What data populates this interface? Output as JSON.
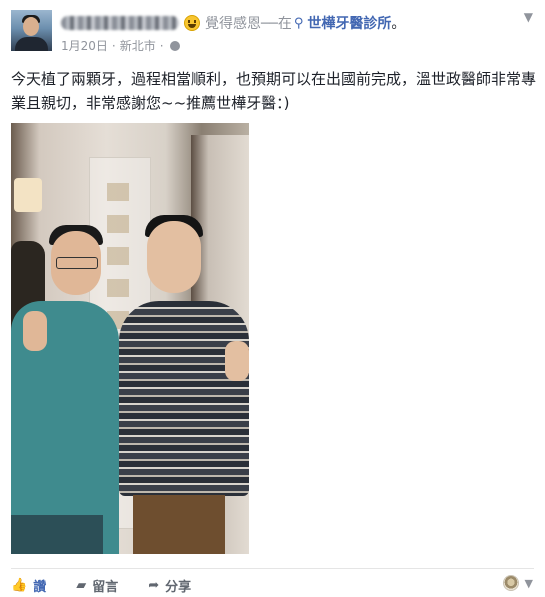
{
  "post": {
    "author_name_redacted": true,
    "feeling_text": "覺得感恩",
    "dash": "──在",
    "place": "世樺牙醫診所",
    "period": "。",
    "date": "1月20日",
    "dot": "·",
    "location": "新北市",
    "body": "今天植了兩顆牙，過程相當順利，也預期可以在出國前完成，溫世政醫師非常專業且親切，非常感謝您~~推薦世樺牙醫：)"
  },
  "actions": {
    "like_label": "讚",
    "comment_label": "留言",
    "share_label": "分享"
  },
  "icons": {
    "caret": "chevron-down-icon",
    "globe": "globe-icon",
    "pin": "location-pin-icon",
    "like": "thumbs-up-icon",
    "comment": "comment-icon",
    "share": "share-icon"
  },
  "colors": {
    "link": "#4267b2",
    "muted": "#90949c",
    "text": "#1d2129"
  }
}
